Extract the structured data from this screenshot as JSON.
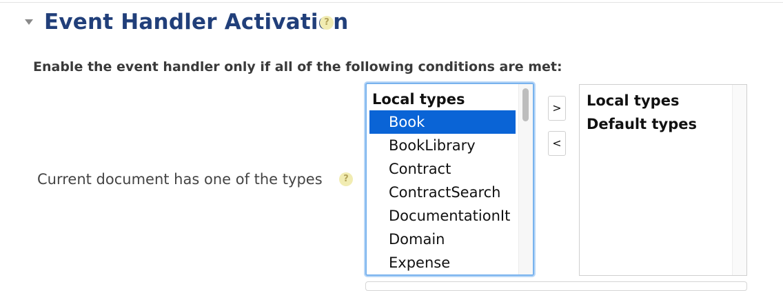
{
  "section": {
    "title": "Event Handler Activation",
    "help_glyph": "?"
  },
  "conditions": {
    "intro": "Enable the event handler only if all of the following conditions are met:",
    "doc_types": {
      "label": "Current document has one of the types",
      "help_glyph": "?",
      "available": {
        "group_label": "Local types",
        "options": [
          "Book",
          "BookLibrary",
          "Contract",
          "ContractSearch",
          "DocumentationIt",
          "Domain",
          "Expense"
        ],
        "selected": "Book"
      },
      "add_button": ">",
      "remove_button": "<",
      "chosen": {
        "groups": [
          "Local types",
          "Default types"
        ]
      }
    }
  },
  "colors": {
    "title": "#213f7a",
    "selected_option": "#0a64d6",
    "focus_border": "#79b3ee",
    "help_icon_bg": "#f1ecb2"
  }
}
